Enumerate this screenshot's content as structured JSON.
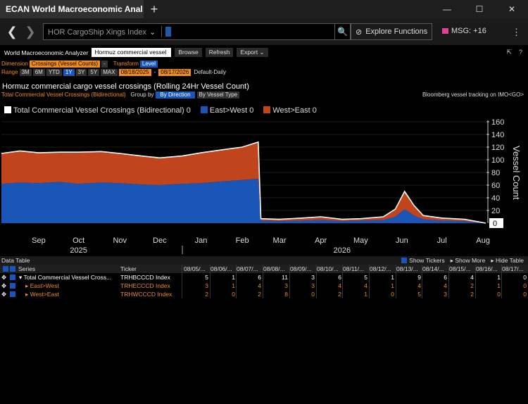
{
  "window": {
    "tab_title": "ECAN World Macroeconomic Anal",
    "close_glyph": "×",
    "newtab_glyph": "+",
    "minimize_glyph": "—",
    "maximize_glyph": "☐",
    "closewin_glyph": "✕"
  },
  "nav": {
    "back_glyph": "❮",
    "forward_glyph": "❯",
    "security": "HOR CargoShip Xings Index",
    "security_chevron": "⌄",
    "search_glyph": "🔍",
    "explore_label": "Explore Functions",
    "explore_glyph": "⊘",
    "msg_label": "MSG: +16",
    "menu_glyph": "⋮"
  },
  "toolbar": {
    "title": "World Macroeconomic Analyzer",
    "view_name": "Hormuz commercial vessel",
    "browse": "Browse",
    "refresh": "Refresh",
    "export": "Export",
    "export_chev": "⌄",
    "open_glyph": "⇱",
    "help_glyph": "?"
  },
  "dimension": {
    "label": "Dimension",
    "value": "Crossings (Vessel Counts)",
    "dd": "-",
    "transform_label": "Transform",
    "transform_value": "Level"
  },
  "range": {
    "label": "Range",
    "buttons": [
      "3M",
      "6M",
      "YTD",
      "1Y",
      "3Y",
      "5Y",
      "MAX"
    ],
    "active": "1Y",
    "start": "08/18/2025",
    "dash": "-",
    "end": "08/17/2026",
    "freq": "Default-Daily"
  },
  "chart_title": "Hormuz commercial cargo vessel crossings (Rolling 24Hr Vessel Count)",
  "subheader": {
    "series": "Total Commercial Vessel Crossings (Bidirectional)",
    "group_by": "Group by",
    "by_direction": "By Direction",
    "by_vessel": "By Vessel Type",
    "source": "Bloomberg vessel tracking on IMO<GO>"
  },
  "legend": [
    {
      "name": "Total Commercial Vessel Crossings (Bidirectional)",
      "value": "0",
      "color": "#ffffff"
    },
    {
      "name": "East>West",
      "value": "0",
      "color": "#1a56b8"
    },
    {
      "name": "West>East",
      "value": "0",
      "color": "#c0441c"
    }
  ],
  "chart_data": {
    "type": "area",
    "ylabel": "Vessel Count",
    "ylim": [
      0,
      160
    ],
    "yticks": [
      0,
      20,
      40,
      60,
      80,
      100,
      120,
      140,
      160
    ],
    "x_months": [
      "Sep",
      "Oct",
      "Nov",
      "Dec",
      "Jan",
      "Feb",
      "Mar",
      "Apr",
      "May",
      "Jun",
      "Jul",
      "Aug"
    ],
    "x_years": [
      "2025",
      "2026"
    ],
    "last_value": "0",
    "x": [
      "2025-08-18",
      "2025-09-01",
      "2025-09-15",
      "2025-10-01",
      "2025-10-15",
      "2025-11-01",
      "2025-11-15",
      "2025-12-01",
      "2025-12-15",
      "2026-01-01",
      "2026-01-15",
      "2026-02-01",
      "2026-02-15",
      "2026-02-27",
      "2026-03-01",
      "2026-03-15",
      "2026-04-01",
      "2026-04-15",
      "2026-05-01",
      "2026-05-15",
      "2026-06-01",
      "2026-06-10",
      "2026-06-17",
      "2026-06-24",
      "2026-07-01",
      "2026-07-15",
      "2026-08-01",
      "2026-08-17"
    ],
    "series": [
      {
        "name": "East>West",
        "values": [
          62,
          64,
          63,
          65,
          62,
          64,
          63,
          61,
          60,
          62,
          63,
          66,
          68,
          70,
          4,
          3,
          4,
          5,
          3,
          4,
          5,
          10,
          22,
          12,
          6,
          4,
          3,
          0
        ]
      },
      {
        "name": "West>East",
        "values": [
          48,
          50,
          48,
          47,
          50,
          49,
          47,
          45,
          43,
          44,
          48,
          50,
          52,
          58,
          3,
          3,
          4,
          5,
          3,
          3,
          5,
          12,
          28,
          16,
          6,
          4,
          3,
          0
        ]
      },
      {
        "name": "Total Commercial Vessel Crossings (Bidirectional)",
        "values": [
          110,
          114,
          111,
          112,
          112,
          113,
          110,
          106,
          103,
          106,
          111,
          116,
          120,
          128,
          7,
          6,
          8,
          10,
          6,
          7,
          10,
          22,
          50,
          28,
          12,
          8,
          6,
          0
        ]
      }
    ]
  },
  "data_table": {
    "title": "Data Table",
    "show_tickers": "Show Tickers",
    "show_more": "Show More",
    "hide_table": "Hide Table",
    "columns": [
      "Series",
      "Ticker",
      "08/05/...",
      "08/06/...",
      "08/07/...",
      "08/08/...",
      "08/09/...",
      "08/10/...",
      "08/11/...",
      "08/12/...",
      "08/13/...",
      "08/14/...",
      "08/15/...",
      "08/16/...",
      "08/17/..."
    ],
    "rows": [
      {
        "series": "Total Commercial Vessel Cross...",
        "ticker": "TRHBCCCD Index",
        "values": [
          "5",
          "1",
          "6",
          "11",
          "3",
          "6",
          "5",
          "1",
          "9",
          "6",
          "4",
          "1",
          "0"
        ],
        "color": "white",
        "prefix": "▾"
      },
      {
        "series": "East>West",
        "ticker": "TRHECCCD Index",
        "values": [
          "3",
          "1",
          "4",
          "3",
          "3",
          "4",
          "4",
          "1",
          "4",
          "4",
          "2",
          "1",
          "0"
        ],
        "color": "orange",
        "prefix": "▸"
      },
      {
        "series": "West>East",
        "ticker": "TRHWCCCD Index",
        "values": [
          "2",
          "0",
          "2",
          "8",
          "0",
          "2",
          "1",
          "0",
          "5",
          "3",
          "2",
          "0",
          "0"
        ],
        "color": "orange",
        "prefix": "▸"
      }
    ]
  }
}
